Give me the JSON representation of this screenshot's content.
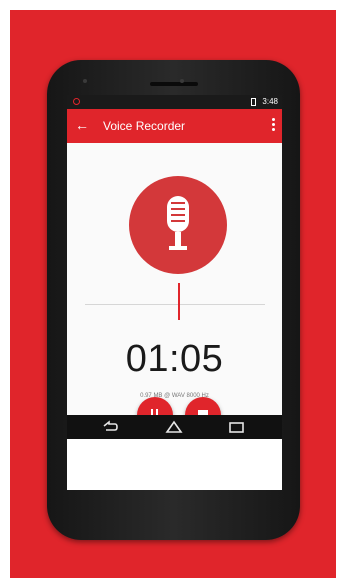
{
  "statusbar": {
    "time": "3:48"
  },
  "appbar": {
    "back_icon": "back-arrow-icon",
    "title": "Voice Recorder",
    "menu_icon": "overflow-menu-icon"
  },
  "recorder": {
    "mic_icon": "microphone-icon",
    "elapsed": "01:05",
    "info": "0.97 MB @ WAV 8000 Hz"
  },
  "controls": {
    "pause_icon": "pause-icon",
    "stop_icon": "stop-icon"
  },
  "navbar": {
    "back_icon": "nav-back-icon",
    "home_icon": "nav-home-icon",
    "recents_icon": "nav-recents-icon"
  },
  "colors": {
    "accent": "#e0252b",
    "mic_circle": "#d3383a",
    "phone_body": "#1e1e1e"
  }
}
